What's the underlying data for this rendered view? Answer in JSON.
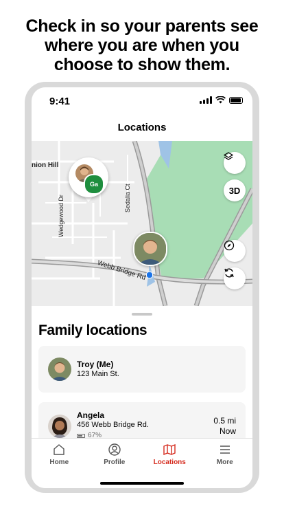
{
  "headline": [
    "Check in so your parents see",
    "where you are when you",
    "choose to show them."
  ],
  "status": {
    "time": "9:41"
  },
  "nav": {
    "title": "Locations"
  },
  "map": {
    "labels": {
      "area": "nion Hill",
      "street1": "Wedgewood Dr",
      "street2": "Sedalia Ct",
      "street3": "Webb Bridge Rd"
    },
    "buttons": {
      "three_d": "3D"
    },
    "pin_initials": "Ga"
  },
  "sheet": {
    "title": "Family locations",
    "members": [
      {
        "name": "Troy (Me)",
        "address": "123 Main St."
      },
      {
        "name": "Angela",
        "address": "456 Webb Bridge Rd.",
        "battery": "67%",
        "distance": "0.5 mi",
        "when": "Now"
      }
    ]
  },
  "tabs": [
    {
      "label": "Home",
      "icon": "home-icon"
    },
    {
      "label": "Profile",
      "icon": "profile-icon"
    },
    {
      "label": "Locations",
      "icon": "map-icon",
      "active": true
    },
    {
      "label": "More",
      "icon": "menu-icon"
    }
  ],
  "colors": {
    "accent": "#d52b1e",
    "park": "#a8ddb5",
    "pin_badge": "#1e8e3e",
    "location_dot": "#1a73e8"
  }
}
